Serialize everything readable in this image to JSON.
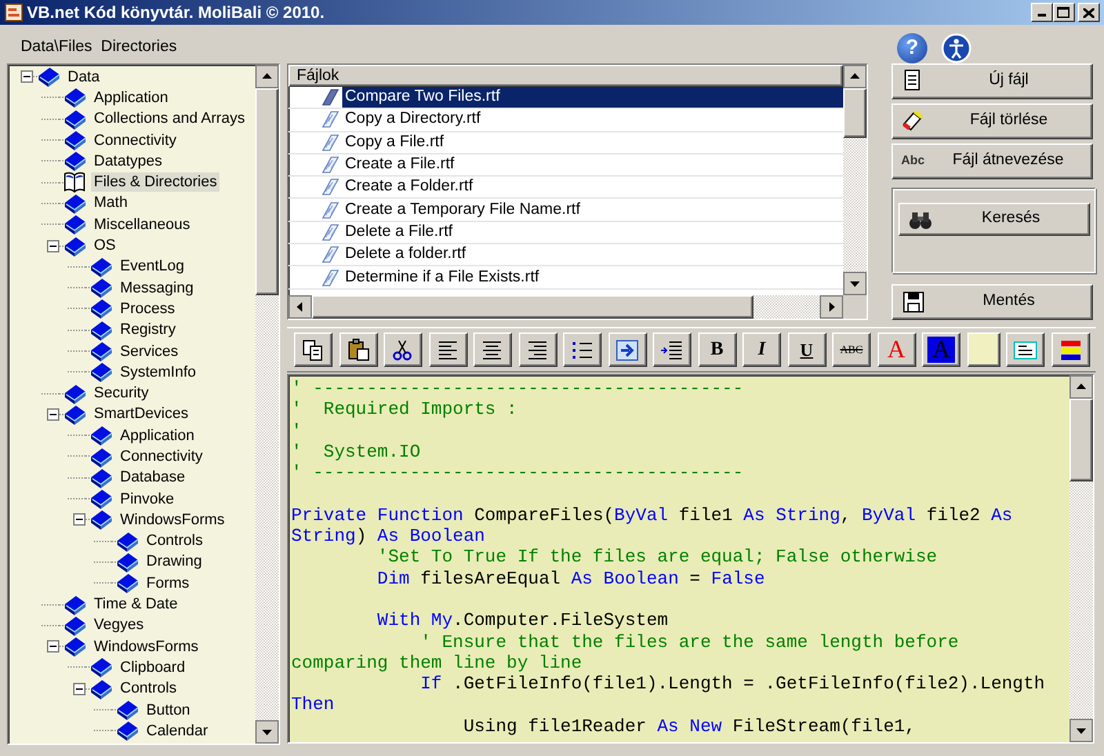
{
  "window": {
    "title": "VB.net Kód könyvtár. MoliBali © 2010."
  },
  "breadcrumb": "Data\\Files  Directories",
  "help_glyph": "?",
  "tree": [
    {
      "label": "Data",
      "expanded": true,
      "selected": false,
      "children": [
        {
          "label": "Application",
          "selected": false
        },
        {
          "label": "Collections and Arrays",
          "selected": false
        },
        {
          "label": "Connectivity",
          "selected": false
        },
        {
          "label": "Datatypes",
          "selected": false
        },
        {
          "label": "Files & Directories",
          "selected": true
        },
        {
          "label": "Math",
          "selected": false
        },
        {
          "label": "Miscellaneous",
          "selected": false
        },
        {
          "label": "OS",
          "expanded": true,
          "selected": false,
          "children": [
            {
              "label": "EventLog",
              "selected": false
            },
            {
              "label": "Messaging",
              "selected": false
            },
            {
              "label": "Process",
              "selected": false
            },
            {
              "label": "Registry",
              "selected": false
            },
            {
              "label": "Services",
              "selected": false
            },
            {
              "label": "SystemInfo",
              "selected": false
            }
          ]
        },
        {
          "label": "Security",
          "selected": false
        },
        {
          "label": "SmartDevices",
          "expanded": true,
          "selected": false,
          "children": [
            {
              "label": "Application",
              "selected": false
            },
            {
              "label": "Connectivity",
              "selected": false
            },
            {
              "label": "Database",
              "selected": false
            },
            {
              "label": "Pinvoke",
              "selected": false
            },
            {
              "label": "WindowsForms",
              "expanded": true,
              "selected": false,
              "children": [
                {
                  "label": "Controls",
                  "selected": false
                },
                {
                  "label": "Drawing",
                  "selected": false
                },
                {
                  "label": "Forms",
                  "selected": false
                }
              ]
            }
          ]
        },
        {
          "label": "Time & Date",
          "selected": false
        },
        {
          "label": "Vegyes",
          "selected": false
        },
        {
          "label": "WindowsForms",
          "expanded": true,
          "selected": false,
          "children": [
            {
              "label": "Clipboard",
              "selected": false
            },
            {
              "label": "Controls",
              "expanded": true,
              "selected": false,
              "children": [
                {
                  "label": "Button",
                  "selected": false
                },
                {
                  "label": "Calendar",
                  "selected": false
                }
              ]
            }
          ]
        }
      ]
    }
  ],
  "files": {
    "header": "Fájlok",
    "rows": [
      {
        "name": "Compare Two Files.rtf",
        "selected": true
      },
      {
        "name": "Copy a Directory.rtf",
        "selected": false
      },
      {
        "name": "Copy a File.rtf",
        "selected": false
      },
      {
        "name": "Create a File.rtf",
        "selected": false
      },
      {
        "name": "Create a Folder.rtf",
        "selected": false
      },
      {
        "name": "Create a Temporary File Name.rtf",
        "selected": false
      },
      {
        "name": "Delete a File.rtf",
        "selected": false
      },
      {
        "name": "Delete a folder.rtf",
        "selected": false
      },
      {
        "name": "Determine if a File Exists.rtf",
        "selected": false
      }
    ]
  },
  "actions": [
    {
      "kind": "new",
      "label": "Új fájl"
    },
    {
      "kind": "delete",
      "label": "Fájl törlése"
    },
    {
      "kind": "rename",
      "label": "Fájl átnevezése",
      "icon_text": "Abc"
    }
  ],
  "search": {
    "label": "Keresés"
  },
  "save": {
    "label": "Mentés"
  },
  "toolbar": [
    {
      "kind": "copy"
    },
    {
      "kind": "paste"
    },
    {
      "kind": "cut"
    },
    {
      "kind": "align-left"
    },
    {
      "kind": "align-center"
    },
    {
      "kind": "align-right"
    },
    {
      "kind": "bullets"
    },
    {
      "kind": "indent"
    },
    {
      "kind": "outdent"
    },
    {
      "kind": "bold",
      "glyph": "B"
    },
    {
      "kind": "italic",
      "glyph": "I"
    },
    {
      "kind": "underline",
      "glyph": "U"
    },
    {
      "kind": "strike",
      "glyph": "ABC"
    },
    {
      "kind": "fore-color",
      "glyph": "A"
    },
    {
      "kind": "back-color",
      "glyph": "A"
    },
    {
      "kind": "swatch"
    },
    {
      "kind": "textbox"
    },
    {
      "kind": "bars"
    }
  ],
  "code": [
    {
      "kind": "code",
      "segments": [
        {
          "kind": "comment",
          "text": "' ----------------------------------------"
        }
      ]
    },
    {
      "kind": "code",
      "segments": [
        {
          "kind": "comment",
          "text": "'  Required Imports :"
        }
      ]
    },
    {
      "kind": "code",
      "segments": [
        {
          "kind": "comment",
          "text": "'"
        }
      ]
    },
    {
      "kind": "code",
      "segments": [
        {
          "kind": "comment",
          "text": "'  System.IO"
        }
      ]
    },
    {
      "kind": "code",
      "segments": [
        {
          "kind": "comment",
          "text": "' ----------------------------------------"
        }
      ]
    },
    {
      "kind": "blank"
    },
    {
      "kind": "code",
      "segments": [
        {
          "kind": "keyword",
          "text": "Private Function"
        },
        {
          "kind": "plain",
          "text": " CompareFiles("
        },
        {
          "kind": "keyword",
          "text": "ByVal"
        },
        {
          "kind": "plain",
          "text": " file1 "
        },
        {
          "kind": "keyword",
          "text": "As String"
        },
        {
          "kind": "plain",
          "text": ", "
        },
        {
          "kind": "keyword",
          "text": "ByVal"
        },
        {
          "kind": "plain",
          "text": " file2 "
        },
        {
          "kind": "keyword",
          "text": "As"
        }
      ]
    },
    {
      "kind": "code",
      "segments": [
        {
          "kind": "keyword",
          "text": "String"
        },
        {
          "kind": "plain",
          "text": ") "
        },
        {
          "kind": "keyword",
          "text": "As Boolean"
        }
      ]
    },
    {
      "kind": "code",
      "segments": [
        {
          "kind": "comment",
          "text": "        'Set To True If the files are equal; False otherwise"
        }
      ]
    },
    {
      "kind": "code",
      "segments": [
        {
          "kind": "keyword",
          "text": "        Dim"
        },
        {
          "kind": "plain",
          "text": " filesAreEqual "
        },
        {
          "kind": "keyword",
          "text": "As Boolean"
        },
        {
          "kind": "plain",
          "text": " = "
        },
        {
          "kind": "keyword",
          "text": "False"
        }
      ]
    },
    {
      "kind": "blank"
    },
    {
      "kind": "code",
      "segments": [
        {
          "kind": "keyword",
          "text": "        With My"
        },
        {
          "kind": "plain",
          "text": ".Computer.FileSystem"
        }
      ]
    },
    {
      "kind": "code",
      "segments": [
        {
          "kind": "comment",
          "text": "            ' Ensure that the files are the same length before"
        }
      ]
    },
    {
      "kind": "code",
      "segments": [
        {
          "kind": "comment",
          "text": "comparing them line by line"
        }
      ]
    },
    {
      "kind": "code",
      "segments": [
        {
          "kind": "keyword",
          "text": "            If"
        },
        {
          "kind": "plain",
          "text": " .GetFileInfo(file1).Length = .GetFileInfo(file2).Length"
        }
      ]
    },
    {
      "kind": "code",
      "segments": [
        {
          "kind": "keyword",
          "text": "Then"
        }
      ]
    },
    {
      "kind": "code",
      "segments": [
        {
          "kind": "plain",
          "text": "                Using file1Reader "
        },
        {
          "kind": "keyword",
          "text": "As New"
        },
        {
          "kind": "plain",
          "text": " FileStream(file1,"
        }
      ]
    }
  ]
}
